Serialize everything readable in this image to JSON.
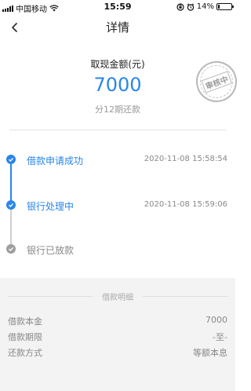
{
  "status_bar": {
    "carrier": "中国移动",
    "time": "15:59",
    "battery": "14%",
    "battery_level": 0.14
  },
  "nav": {
    "title": "详情"
  },
  "summary": {
    "amount_label": "取现金额(元)",
    "amount": "7000",
    "term": "分12期还款",
    "stamp_text": "审核中"
  },
  "timeline": [
    {
      "label": "借款申请成功",
      "time": "2020-11-08 15:58:54",
      "state": "done"
    },
    {
      "label": "银行处理中",
      "time": "2020-11-08 15:59:06",
      "state": "done"
    },
    {
      "label": "银行已放款",
      "time": "",
      "state": "pending"
    }
  ],
  "detail": {
    "title": "借款明细",
    "rows": [
      {
        "key": "借款本金",
        "value": "7000"
      },
      {
        "key": "借款期限",
        "value": "-至-"
      },
      {
        "key": "还款方式",
        "value": "等额本息"
      }
    ]
  },
  "colors": {
    "accent": "#2a86e8",
    "pending": "#9e9e9e",
    "detail_bg": "#f3f3f3"
  }
}
